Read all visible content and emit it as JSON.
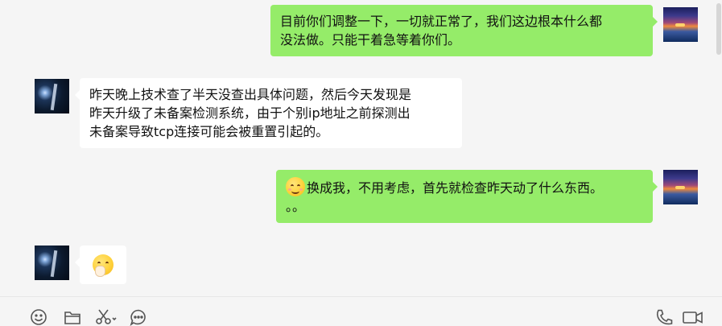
{
  "messages": [
    {
      "sender": "me",
      "text_line1": "目前你们调整一下，一切就正常了，我们这边根本什么都",
      "text_line2": "没法做。只能干着急等着你们。"
    },
    {
      "sender": "them",
      "text_line1": "昨天晚上技术查了半天没查出具体问题，然后今天发现是",
      "text_line2": "昨天升级了未备案检测系统，由于个别ip地址之前探测出",
      "text_line3": "未备案导致tcp连接可能会被重置引起的。"
    },
    {
      "sender": "me",
      "emoji": "smiling-blush-emoji",
      "text_line1": "换成我，不用考虑，首先就检查昨天动了什么东西。",
      "text_line2": "。。"
    },
    {
      "sender": "them",
      "emoji": "shushing-emoji"
    }
  ],
  "toolbar": {
    "left_icons": [
      "emoji-icon",
      "folder-icon",
      "scissors-icon",
      "chat-history-icon"
    ],
    "right_icons": [
      "phone-call-icon",
      "video-call-icon"
    ]
  },
  "colors": {
    "my_bubble": "#95ec69",
    "their_bubble": "#ffffff",
    "background": "#f5f5f5"
  }
}
